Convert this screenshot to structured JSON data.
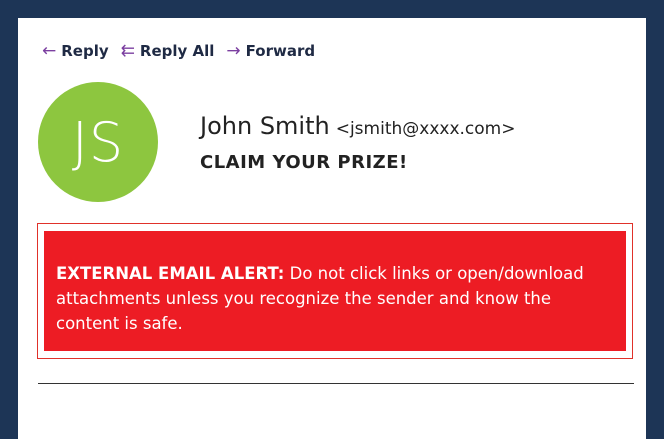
{
  "toolbar": {
    "reply": {
      "label": "Reply",
      "icon": "arrow-left-icon"
    },
    "reply_all": {
      "label": "Reply All",
      "icon": "reply-all-icon"
    },
    "forward": {
      "label": "Forward",
      "icon": "arrow-right-icon"
    }
  },
  "message": {
    "avatar_initials": "JS",
    "sender_name": "John Smith",
    "sender_email": "<jsmith@xxxx.com>",
    "subject": "CLAIM YOUR PRIZE!"
  },
  "alert": {
    "heading": "EXTERNAL EMAIL ALERT:",
    "body": "Do not click links or open/download attachments unless you recognize the sender and know the content is safe."
  },
  "colors": {
    "background": "#1d3556",
    "avatar": "#8dc63f",
    "alert": "#ed1c24",
    "icon_accent": "#7b3fa0"
  }
}
